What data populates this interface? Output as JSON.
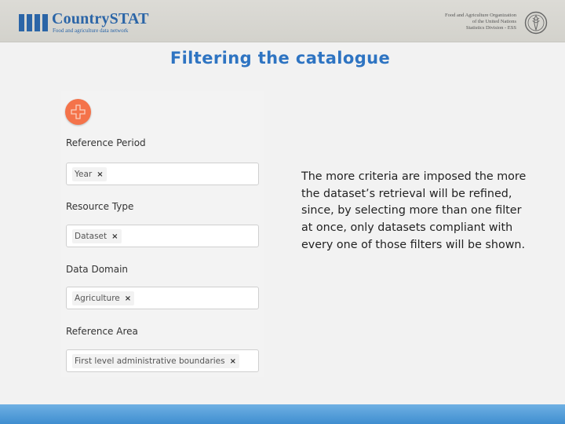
{
  "header": {
    "brand_title": "CountrySTAT",
    "brand_subtitle": "Food and agriculture data network",
    "org_lines": [
      "Food and Agriculture Organization",
      "of the United Nations",
      "Statistics Division - ESS"
    ],
    "brand_color": "#2b65a7"
  },
  "slide": {
    "title": "Filtering the catalogue",
    "description": "The more criteria are imposed the more the dataset’s retrieval will be refined, since, by selecting more than one filter at once, only datasets compliant with every one of those filters will be shown."
  },
  "panel": {
    "add_button_color": "#f4734a",
    "add_icon": "plus-icon",
    "filters": [
      {
        "label": "Reference Period",
        "tag": "Year",
        "remove": "×"
      },
      {
        "label": "Resource Type",
        "tag": "Dataset",
        "remove": "×"
      },
      {
        "label": "Data Domain",
        "tag": "Agriculture",
        "remove": "×"
      },
      {
        "label": "Reference Area",
        "tag": "First level administrative boundaries",
        "remove": "×"
      }
    ]
  },
  "colors": {
    "title": "#2e74c2",
    "footer": "#3f8ed0"
  }
}
